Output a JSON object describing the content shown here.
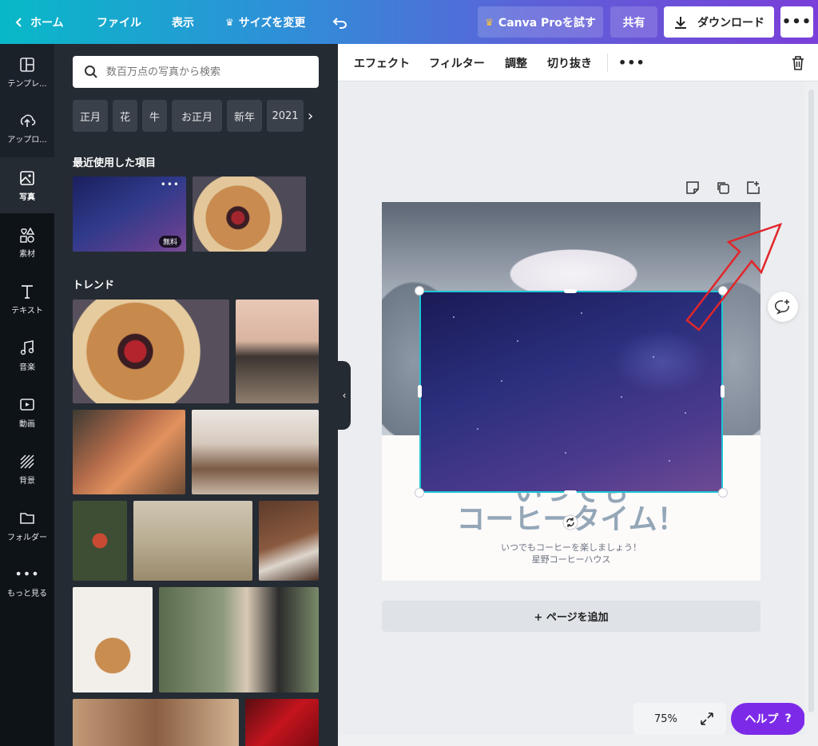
{
  "topbar": {
    "home": "ホーム",
    "file": "ファイル",
    "view": "表示",
    "resize": "サイズを変更",
    "try_pro": "Canva Proを試す",
    "share": "共有",
    "download": "ダウンロード"
  },
  "rail": [
    {
      "label": "テンプレ...",
      "icon": "template-icon"
    },
    {
      "label": "アップロ...",
      "icon": "upload-icon"
    },
    {
      "label": "写真",
      "icon": "photo-icon"
    },
    {
      "label": "素材",
      "icon": "elements-icon"
    },
    {
      "label": "テキスト",
      "icon": "text-icon"
    },
    {
      "label": "音楽",
      "icon": "music-icon"
    },
    {
      "label": "動画",
      "icon": "video-icon"
    },
    {
      "label": "背景",
      "icon": "background-icon"
    },
    {
      "label": "フォルダー",
      "icon": "folder-icon"
    },
    {
      "label": "もっと見る",
      "icon": "more-icon"
    }
  ],
  "panel": {
    "search_placeholder": "数百万点の写真から検索",
    "chips": [
      "正月",
      "花",
      "牛",
      "お正月",
      "新年",
      "2021"
    ],
    "recent_title": "最近使用した項目",
    "free_badge": "無料",
    "trend_title": "トレンド"
  },
  "edit_toolbar": {
    "effect": "エフェクト",
    "filter": "フィルター",
    "adjust": "調整",
    "crop": "切り抜き"
  },
  "design": {
    "title_line1": "いつでも",
    "title_line2": "コーヒータイム！",
    "sub_line1": "いつでもコーヒーを楽しましょう！",
    "sub_line2": "星野コーヒーハウス"
  },
  "add_page": "+ ページを追加",
  "zoom": "75%",
  "help": "ヘルプ",
  "help_mark": "?",
  "colors": {
    "accent": "#7d2ae8",
    "selection": "#1ec6d6",
    "annotation": "#e0262b"
  }
}
